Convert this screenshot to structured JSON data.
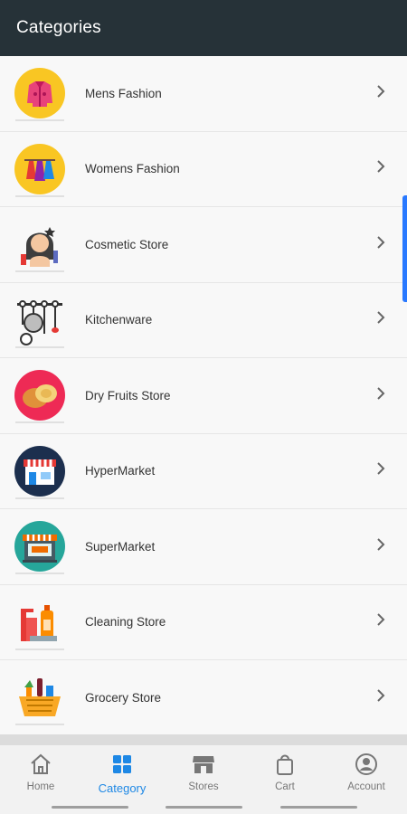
{
  "header": {
    "title": "Categories"
  },
  "categories": [
    {
      "label": "Mens Fashion",
      "icon": "jacket-icon"
    },
    {
      "label": "Womens Fashion",
      "icon": "dresses-icon"
    },
    {
      "label": "Cosmetic Store",
      "icon": "woman-makeup-icon"
    },
    {
      "label": "Kitchenware",
      "icon": "kitchen-utensils-icon"
    },
    {
      "label": "Dry Fruits Store",
      "icon": "nuts-icon"
    },
    {
      "label": "HyperMarket",
      "icon": "store-front-icon"
    },
    {
      "label": "SuperMarket",
      "icon": "open-shop-icon"
    },
    {
      "label": "Cleaning Store",
      "icon": "cleaning-bottles-icon"
    },
    {
      "label": "Grocery Store",
      "icon": "grocery-basket-icon"
    }
  ],
  "nav": {
    "home": "Home",
    "category": "Category",
    "stores": "Stores",
    "cart": "Cart",
    "account": "Account"
  },
  "colors": {
    "appbar": "#263238",
    "accent": "#1e88e5"
  }
}
